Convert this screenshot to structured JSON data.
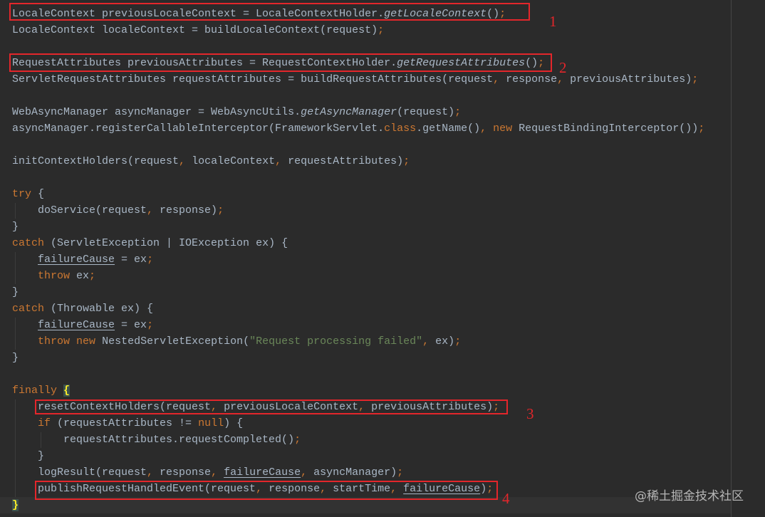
{
  "colors": {
    "background": "#2b2b2b",
    "text": "#a9b7c6",
    "keyword": "#cc7832",
    "string": "#6a8759",
    "annotation": "#e3262b"
  },
  "editor": {
    "lines": [
      [
        [
          "LocaleContext previousLocaleContext = LocaleContextHolder.",
          "text"
        ],
        [
          "getLocaleContext",
          "static-call"
        ],
        [
          "()",
          "text"
        ],
        [
          ";",
          "punct"
        ]
      ],
      [
        [
          "LocaleContext localeContext = buildLocaleContext(request)",
          "text"
        ],
        [
          ";",
          "punct"
        ]
      ],
      [],
      [
        [
          "RequestAttributes previousAttributes = RequestContextHolder.",
          "text"
        ],
        [
          "getRequestAttributes",
          "static-call"
        ],
        [
          "()",
          "text"
        ],
        [
          ";",
          "punct"
        ]
      ],
      [
        [
          "ServletRequestAttributes requestAttributes = buildRequestAttributes(request",
          "text"
        ],
        [
          ",",
          "punct"
        ],
        [
          " response",
          "text"
        ],
        [
          ",",
          "punct"
        ],
        [
          " previousAttributes)",
          "text"
        ],
        [
          ";",
          "punct"
        ]
      ],
      [],
      [
        [
          "WebAsyncManager asyncManager = WebAsyncUtils.",
          "text"
        ],
        [
          "getAsyncManager",
          "static-call"
        ],
        [
          "(request)",
          "text"
        ],
        [
          ";",
          "punct"
        ]
      ],
      [
        [
          "asyncManager.registerCallableInterceptor(FrameworkServlet.",
          "text"
        ],
        [
          "class",
          "keyword"
        ],
        [
          ".getName()",
          "text"
        ],
        [
          ",",
          "punct"
        ],
        [
          " ",
          "text"
        ],
        [
          "new",
          "keyword"
        ],
        [
          " RequestBindingInterceptor())",
          "text"
        ],
        [
          ";",
          "punct"
        ]
      ],
      [],
      [
        [
          "initContextHolders(request",
          "text"
        ],
        [
          ",",
          "punct"
        ],
        [
          " localeContext",
          "text"
        ],
        [
          ",",
          "punct"
        ],
        [
          " requestAttributes)",
          "text"
        ],
        [
          ";",
          "punct"
        ]
      ],
      [],
      [
        [
          "try",
          "keyword"
        ],
        [
          " {",
          "text"
        ]
      ],
      [
        [
          "    doService(request",
          "text"
        ],
        [
          ",",
          "punct"
        ],
        [
          " response)",
          "text"
        ],
        [
          ";",
          "punct"
        ]
      ],
      [
        [
          "}",
          "text"
        ]
      ],
      [
        [
          "catch",
          "keyword"
        ],
        [
          " (ServletException | IOException ex) {",
          "text"
        ]
      ],
      [
        [
          "    ",
          "text"
        ],
        [
          "failureCause",
          "reassigned-var"
        ],
        [
          " = ex",
          "text"
        ],
        [
          ";",
          "punct"
        ]
      ],
      [
        [
          "    ",
          "text"
        ],
        [
          "throw",
          "keyword"
        ],
        [
          " ex",
          "text"
        ],
        [
          ";",
          "punct"
        ]
      ],
      [
        [
          "}",
          "text"
        ]
      ],
      [
        [
          "catch",
          "keyword"
        ],
        [
          " (Throwable ex) {",
          "text"
        ]
      ],
      [
        [
          "    ",
          "text"
        ],
        [
          "failureCause",
          "reassigned-var"
        ],
        [
          " = ex",
          "text"
        ],
        [
          ";",
          "punct"
        ]
      ],
      [
        [
          "    ",
          "text"
        ],
        [
          "throw",
          "keyword"
        ],
        [
          " ",
          "text"
        ],
        [
          "new",
          "keyword"
        ],
        [
          " NestedServletException(",
          "text"
        ],
        [
          "\"Request processing failed\"",
          "string"
        ],
        [
          ",",
          "punct"
        ],
        [
          " ex)",
          "text"
        ],
        [
          ";",
          "punct"
        ]
      ],
      [
        [
          "}",
          "text"
        ]
      ],
      [],
      [
        [
          "finally",
          "keyword"
        ],
        [
          " ",
          "text"
        ],
        [
          "{",
          "matched-brace"
        ]
      ],
      [
        [
          "    resetContextHolders(request",
          "text"
        ],
        [
          ",",
          "punct"
        ],
        [
          " previousLocaleContext",
          "text"
        ],
        [
          ",",
          "punct"
        ],
        [
          " previousAttributes)",
          "text"
        ],
        [
          ";",
          "punct"
        ]
      ],
      [
        [
          "    ",
          "text"
        ],
        [
          "if",
          "keyword"
        ],
        [
          " (requestAttributes != ",
          "text"
        ],
        [
          "null",
          "keyword"
        ],
        [
          ") {",
          "text"
        ]
      ],
      [
        [
          "        requestAttributes.requestCompleted()",
          "text"
        ],
        [
          ";",
          "punct"
        ]
      ],
      [
        [
          "    }",
          "text"
        ]
      ],
      [
        [
          "    logResult(request",
          "text"
        ],
        [
          ",",
          "punct"
        ],
        [
          " response",
          "text"
        ],
        [
          ",",
          "punct"
        ],
        [
          " ",
          "text"
        ],
        [
          "failureCause",
          "reassigned-var"
        ],
        [
          ",",
          "punct"
        ],
        [
          " asyncManager)",
          "text"
        ],
        [
          ";",
          "punct"
        ]
      ],
      [
        [
          "    publishRequestHandledEvent(request",
          "text"
        ],
        [
          ",",
          "punct"
        ],
        [
          " response",
          "text"
        ],
        [
          ",",
          "punct"
        ],
        [
          " startTime",
          "text"
        ],
        [
          ",",
          "punct"
        ],
        [
          " ",
          "text"
        ],
        [
          "failureCause",
          "reassigned-var"
        ],
        [
          ")",
          "text"
        ],
        [
          ";",
          "punct"
        ]
      ],
      [
        [
          "}",
          "matched-brace"
        ]
      ]
    ]
  },
  "annotations": [
    {
      "label": "1"
    },
    {
      "label": "2"
    },
    {
      "label": "3"
    },
    {
      "label": "4"
    }
  ],
  "watermark": "@稀土掘金技术社区"
}
